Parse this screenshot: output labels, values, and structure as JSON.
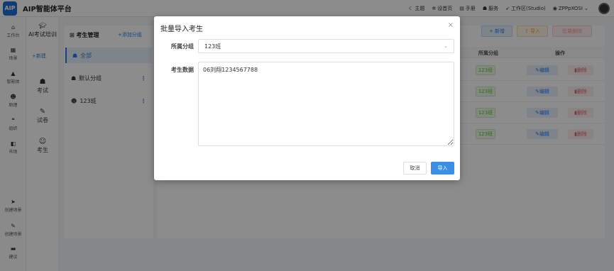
{
  "app": {
    "logo_text": "AIP",
    "title": "AIP智能体平台"
  },
  "top_nav": [
    {
      "icon": "moon-icon",
      "label": "主题"
    },
    {
      "icon": "gear-icon",
      "label": "设首页"
    },
    {
      "icon": "book-icon",
      "label": "手册"
    },
    {
      "icon": "user-icon",
      "label": "服务"
    },
    {
      "icon": "rocket-icon",
      "label": "工作区(Studio)"
    },
    {
      "icon": "circle-icon",
      "label": "ZPPpXOSI ⌄"
    }
  ],
  "rail": [
    {
      "icon": "home-icon",
      "label": "工作台"
    },
    {
      "icon": "grid-icon",
      "label": "场景"
    },
    {
      "icon": "triangle-icon",
      "label": "智能体"
    },
    {
      "icon": "person-icon",
      "label": "助理"
    },
    {
      "icon": "chat-icon",
      "label": "组织"
    },
    {
      "icon": "shop-icon",
      "label": "市场"
    },
    {
      "icon": "send-icon",
      "label": "创建场景"
    },
    {
      "icon": "pen-icon",
      "label": "创建场景"
    },
    {
      "icon": "comment-icon",
      "label": "建议"
    }
  ],
  "col2": {
    "title": "AI考试培训",
    "new_label": "+新建",
    "nav": [
      {
        "label": "考试"
      },
      {
        "label": "试卷"
      },
      {
        "label": "考生"
      }
    ]
  },
  "groups": {
    "header": "考生管理",
    "add_label": "+添加分组",
    "items": [
      {
        "label": "全部",
        "active": true
      },
      {
        "label": "默认分组"
      },
      {
        "label": "123班"
      }
    ]
  },
  "main": {
    "btn_new": "+ 新增",
    "btn_import": "⇧ 导入",
    "btn_delete": "批量删除",
    "col_group": "所属分组",
    "col_action": "操作",
    "rows": [
      {
        "group": "123班",
        "edit": "编辑",
        "delete": "删除"
      },
      {
        "group": "123班",
        "edit": "编辑",
        "delete": "删除"
      },
      {
        "group": "123班",
        "edit": "编辑",
        "delete": "删除"
      },
      {
        "group": "123班",
        "edit": "编辑",
        "delete": "删除"
      }
    ]
  },
  "modal": {
    "title": "批量导入考生",
    "close": "×",
    "group_label": "所属分组",
    "group_value": "123班",
    "data_label": "考生数据",
    "data_value": "06刘翔1234567788",
    "cancel": "取消",
    "confirm": "导入"
  }
}
